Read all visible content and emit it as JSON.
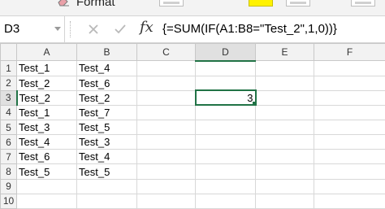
{
  "ribbon": {
    "format_label": "Format"
  },
  "formula_bar": {
    "name_box": "D3",
    "cancel_icon": "x-icon",
    "enter_icon": "check-icon",
    "fx_label": "fx",
    "formula": "{=SUM(IF(A1:B8=\"Test_2\",1,0))}"
  },
  "sheet": {
    "columns": [
      "A",
      "B",
      "C",
      "D",
      "E",
      "F"
    ],
    "row_numbers": [
      "1",
      "2",
      "3",
      "4",
      "5",
      "6",
      "7",
      "8",
      "9",
      "10"
    ],
    "cells": [
      [
        "Test_1",
        "Test_4",
        "",
        "",
        "",
        ""
      ],
      [
        "Test_2",
        "Test_6",
        "",
        "",
        "",
        ""
      ],
      [
        "Test_2",
        "Test_2",
        "",
        "3",
        "",
        ""
      ],
      [
        "Test_1",
        "Test_7",
        "",
        "",
        "",
        ""
      ],
      [
        "Test_3",
        "Test_5",
        "",
        "",
        "",
        ""
      ],
      [
        "Test_4",
        "Test_3",
        "",
        "",
        "",
        ""
      ],
      [
        "Test_6",
        "Test_4",
        "",
        "",
        "",
        ""
      ],
      [
        "Test_5",
        "Test_5",
        "",
        "",
        "",
        ""
      ],
      [
        "",
        "",
        "",
        "",
        "",
        ""
      ],
      [
        "",
        "",
        "",
        "",
        "",
        ""
      ]
    ],
    "selected_cell": "D3",
    "colors": {
      "selection": "#217346",
      "header_bg": "#f2f2f2",
      "gridline": "#d8d8d8",
      "fill_color_swatch": "#fff200"
    }
  }
}
